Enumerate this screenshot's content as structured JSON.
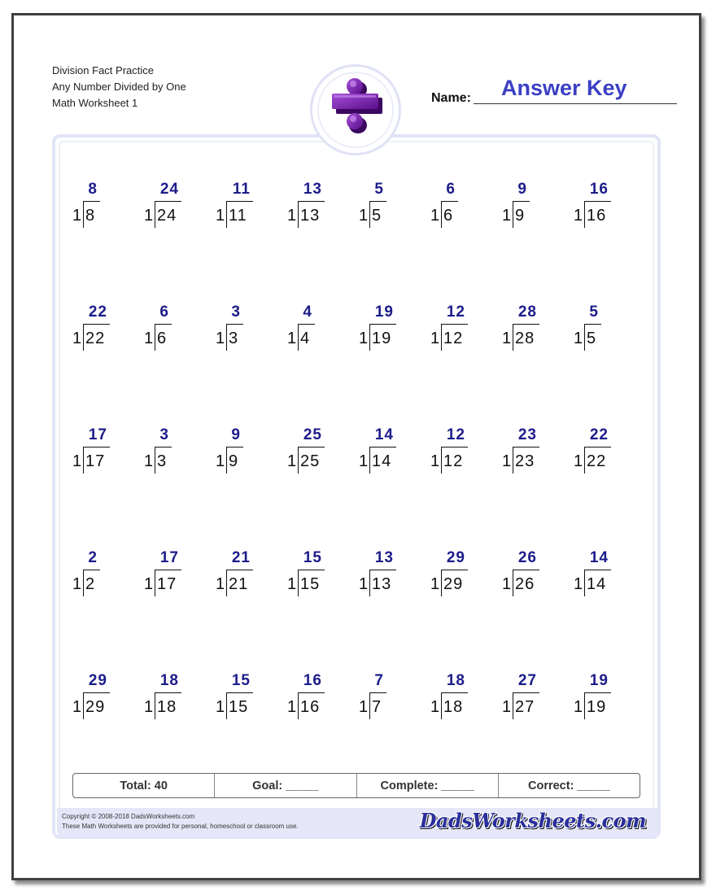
{
  "header": {
    "title_lines": [
      "Division Fact Practice",
      "Any Number Divided by One",
      "Math Worksheet 1"
    ],
    "name_label": "Name:",
    "name_value": "Answer Key",
    "emblem_icon": "division-sign-icon"
  },
  "colors": {
    "answer": "#1c1c8a",
    "answer_key": "#3b3fc4",
    "frame": "#e2e4f7",
    "footer_bg": "#e5e7f8",
    "emblem": "#6a1a9a"
  },
  "problems": [
    [
      {
        "divisor": "1",
        "dividend": "8",
        "quotient": "8"
      },
      {
        "divisor": "1",
        "dividend": "24",
        "quotient": "24"
      },
      {
        "divisor": "1",
        "dividend": "11",
        "quotient": "11"
      },
      {
        "divisor": "1",
        "dividend": "13",
        "quotient": "13"
      },
      {
        "divisor": "1",
        "dividend": "5",
        "quotient": "5"
      },
      {
        "divisor": "1",
        "dividend": "6",
        "quotient": "6"
      },
      {
        "divisor": "1",
        "dividend": "9",
        "quotient": "9"
      },
      {
        "divisor": "1",
        "dividend": "16",
        "quotient": "16"
      }
    ],
    [
      {
        "divisor": "1",
        "dividend": "22",
        "quotient": "22"
      },
      {
        "divisor": "1",
        "dividend": "6",
        "quotient": "6"
      },
      {
        "divisor": "1",
        "dividend": "3",
        "quotient": "3"
      },
      {
        "divisor": "1",
        "dividend": "4",
        "quotient": "4"
      },
      {
        "divisor": "1",
        "dividend": "19",
        "quotient": "19"
      },
      {
        "divisor": "1",
        "dividend": "12",
        "quotient": "12"
      },
      {
        "divisor": "1",
        "dividend": "28",
        "quotient": "28"
      },
      {
        "divisor": "1",
        "dividend": "5",
        "quotient": "5"
      }
    ],
    [
      {
        "divisor": "1",
        "dividend": "17",
        "quotient": "17"
      },
      {
        "divisor": "1",
        "dividend": "3",
        "quotient": "3"
      },
      {
        "divisor": "1",
        "dividend": "9",
        "quotient": "9"
      },
      {
        "divisor": "1",
        "dividend": "25",
        "quotient": "25"
      },
      {
        "divisor": "1",
        "dividend": "14",
        "quotient": "14"
      },
      {
        "divisor": "1",
        "dividend": "12",
        "quotient": "12"
      },
      {
        "divisor": "1",
        "dividend": "23",
        "quotient": "23"
      },
      {
        "divisor": "1",
        "dividend": "22",
        "quotient": "22"
      }
    ],
    [
      {
        "divisor": "1",
        "dividend": "2",
        "quotient": "2"
      },
      {
        "divisor": "1",
        "dividend": "17",
        "quotient": "17"
      },
      {
        "divisor": "1",
        "dividend": "21",
        "quotient": "21"
      },
      {
        "divisor": "1",
        "dividend": "15",
        "quotient": "15"
      },
      {
        "divisor": "1",
        "dividend": "13",
        "quotient": "13"
      },
      {
        "divisor": "1",
        "dividend": "29",
        "quotient": "29"
      },
      {
        "divisor": "1",
        "dividend": "26",
        "quotient": "26"
      },
      {
        "divisor": "1",
        "dividend": "14",
        "quotient": "14"
      }
    ],
    [
      {
        "divisor": "1",
        "dividend": "29",
        "quotient": "29"
      },
      {
        "divisor": "1",
        "dividend": "18",
        "quotient": "18"
      },
      {
        "divisor": "1",
        "dividend": "15",
        "quotient": "15"
      },
      {
        "divisor": "1",
        "dividend": "16",
        "quotient": "16"
      },
      {
        "divisor": "1",
        "dividend": "7",
        "quotient": "7"
      },
      {
        "divisor": "1",
        "dividend": "18",
        "quotient": "18"
      },
      {
        "divisor": "1",
        "dividend": "27",
        "quotient": "27"
      },
      {
        "divisor": "1",
        "dividend": "19",
        "quotient": "19"
      }
    ]
  ],
  "score": {
    "total": "Total: 40",
    "goal": "Goal: _____",
    "complete": "Complete: _____",
    "correct": "Correct: _____"
  },
  "footer": {
    "copyright_line1": "Copyright © 2008-2018 DadsWorksheets.com",
    "copyright_line2": "These Math Worksheets are provided for personal, homeschool or classroom use.",
    "brand": "DadsWorksheets.com"
  }
}
